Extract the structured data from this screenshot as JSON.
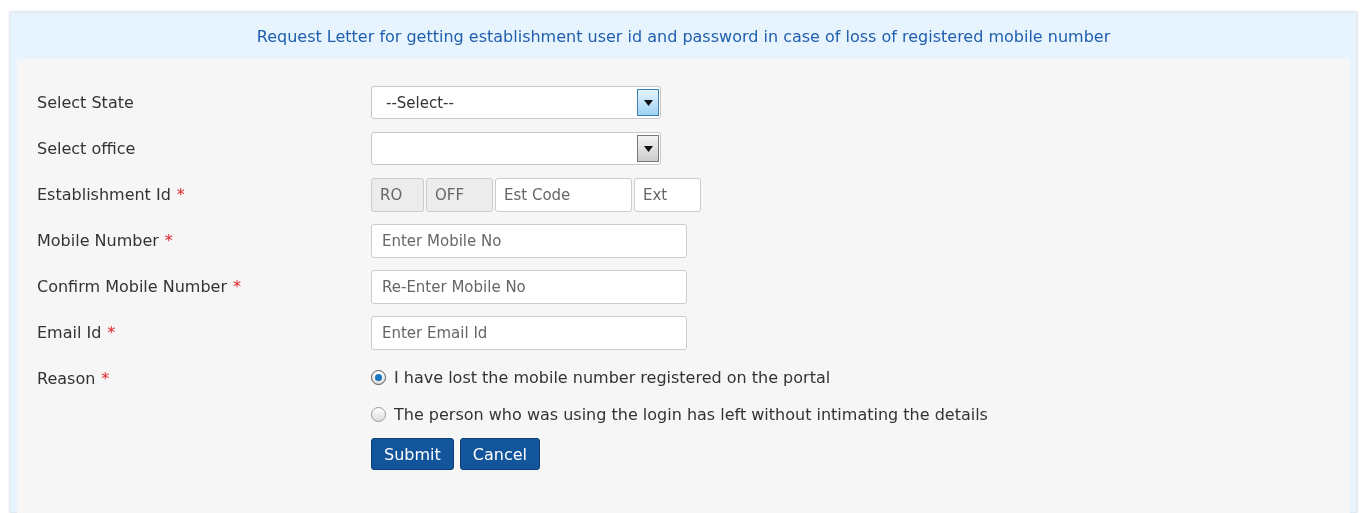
{
  "title": "Request Letter for getting establishment user id and password in case of loss of registered mobile number",
  "rows": [
    {
      "label": "Select State",
      "kind": "select",
      "value": "--Select--",
      "focused": true
    },
    {
      "label": "Select office",
      "kind": "select",
      "focused": false
    },
    {
      "label": "Establishment Id",
      "required_mark": "*",
      "kind": "segments",
      "segments": [
        {
          "placeholder": "RO",
          "disabled": true
        },
        {
          "placeholder": "OFF",
          "disabled": true
        },
        {
          "placeholder": "Est Code",
          "disabled": false
        },
        {
          "placeholder": "Ext",
          "disabled": false
        }
      ]
    },
    {
      "label": "Mobile Number",
      "required_mark": "*",
      "kind": "text",
      "placeholder": "Enter Mobile No"
    },
    {
      "label": "Confirm Mobile Number",
      "required_mark": "*",
      "kind": "text",
      "placeholder": "Re-Enter Mobile No"
    },
    {
      "label": "Email Id",
      "required_mark": "*",
      "kind": "text",
      "placeholder": "Enter Email Id"
    },
    {
      "label": "Reason",
      "required_mark": "*",
      "kind": "radio",
      "options": [
        {
          "label": "I have lost the mobile number registered on the portal",
          "selected": true
        },
        {
          "label": "The person who was using the login has left without intimating the details",
          "selected": false
        }
      ]
    }
  ],
  "buttons": [
    "Submit",
    "Cancel"
  ]
}
